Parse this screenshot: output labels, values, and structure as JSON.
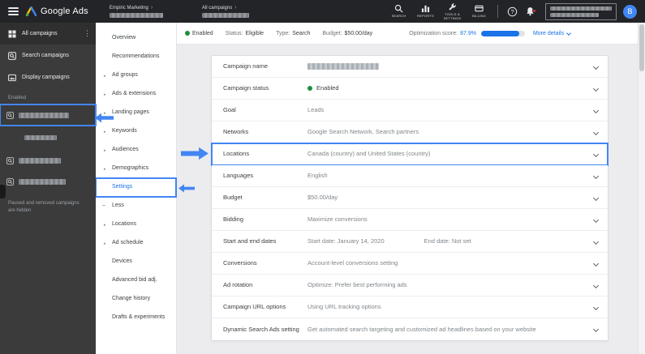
{
  "colors": {
    "accent": "#1a73e8",
    "annotation": "#4285f4",
    "green": "#1e8e3e"
  },
  "topbar": {
    "product": "Google Ads",
    "breadcrumbs": [
      {
        "label": "Empiric Marketing"
      },
      {
        "label": "All campaigns"
      }
    ],
    "nav_icons": [
      {
        "label": "SEARCH",
        "icon": "search-icon"
      },
      {
        "label": "REPORTS",
        "icon": "reports-icon"
      },
      {
        "label": "TOOLS & SETTINGS",
        "icon": "tools-icon"
      },
      {
        "label": "BILLING",
        "icon": "billing-icon"
      }
    ],
    "avatar_initial": "B"
  },
  "sidebar": {
    "items": [
      {
        "label": "All campaigns",
        "icon": "grid-icon"
      },
      {
        "label": "Search campaigns",
        "icon": "search-campaigns-icon"
      },
      {
        "label": "Display campaigns",
        "icon": "display-campaigns-icon"
      }
    ],
    "section_label": "Enabled",
    "note": "Paused and removed campaigns are hidden"
  },
  "subnav": {
    "items": [
      {
        "label": "Overview",
        "expandable": false,
        "active": false
      },
      {
        "label": "Recommendations",
        "expandable": false,
        "active": false
      },
      {
        "label": "Ad groups",
        "expandable": true,
        "active": false
      },
      {
        "label": "Ads & extensions",
        "expandable": true,
        "active": false
      },
      {
        "label": "Landing pages",
        "expandable": true,
        "active": false
      },
      {
        "label": "Keywords",
        "expandable": true,
        "active": false
      },
      {
        "label": "Audiences",
        "expandable": true,
        "active": false
      },
      {
        "label": "Demographics",
        "expandable": true,
        "active": false
      },
      {
        "label": "Settings",
        "expandable": false,
        "active": true,
        "annotated": true
      },
      {
        "label": "Less",
        "expandable": false,
        "active": false,
        "collapse": true
      },
      {
        "label": "Locations",
        "expandable": true,
        "active": false
      },
      {
        "label": "Ad schedule",
        "expandable": true,
        "active": false
      },
      {
        "label": "Devices",
        "expandable": false,
        "active": false
      },
      {
        "label": "Advanced bid adj.",
        "expandable": false,
        "active": false
      },
      {
        "label": "Change history",
        "expandable": false,
        "active": false
      },
      {
        "label": "Drafts & experiments",
        "expandable": false,
        "active": false
      }
    ]
  },
  "statusbar": {
    "enabled": "Enabled",
    "status_label": "Status:",
    "status_value": "Eligible",
    "type_label": "Type:",
    "type_value": "Search",
    "budget_label": "Budget:",
    "budget_value": "$50.00/day",
    "optimization_label": "Optimization score:",
    "optimization_value": "87.9%",
    "optimization_percent": 87.9,
    "more_details": "More details"
  },
  "settings_panel": {
    "rows": [
      {
        "label": "Campaign name",
        "value": "",
        "redacted": true
      },
      {
        "label": "Campaign status",
        "value": "Enabled",
        "status_dot": true
      },
      {
        "label": "Goal",
        "value": "Leads"
      },
      {
        "label": "Networks",
        "value": "Google Search Network, Search partners"
      },
      {
        "label": "Locations",
        "value": "Canada (country) and United States (country)",
        "highlighted": true
      },
      {
        "label": "Languages",
        "value": "English"
      },
      {
        "label": "Budget",
        "value": "$50.00/day"
      },
      {
        "label": "Bidding",
        "value": "Maximize conversions"
      },
      {
        "label": "Start and end dates",
        "value": "Start date: January 14, 2020",
        "value2": "End date: Not set"
      },
      {
        "label": "Conversions",
        "value": "Account-level conversions setting"
      },
      {
        "label": "Ad rotation",
        "value": "Optimize: Prefer best performing ads"
      },
      {
        "label": "Campaign URL options",
        "value": "Using URL tracking options"
      },
      {
        "label": "Dynamic Search Ads setting",
        "value": "Get automated search targeting and customized ad headlines based on your website"
      }
    ]
  }
}
